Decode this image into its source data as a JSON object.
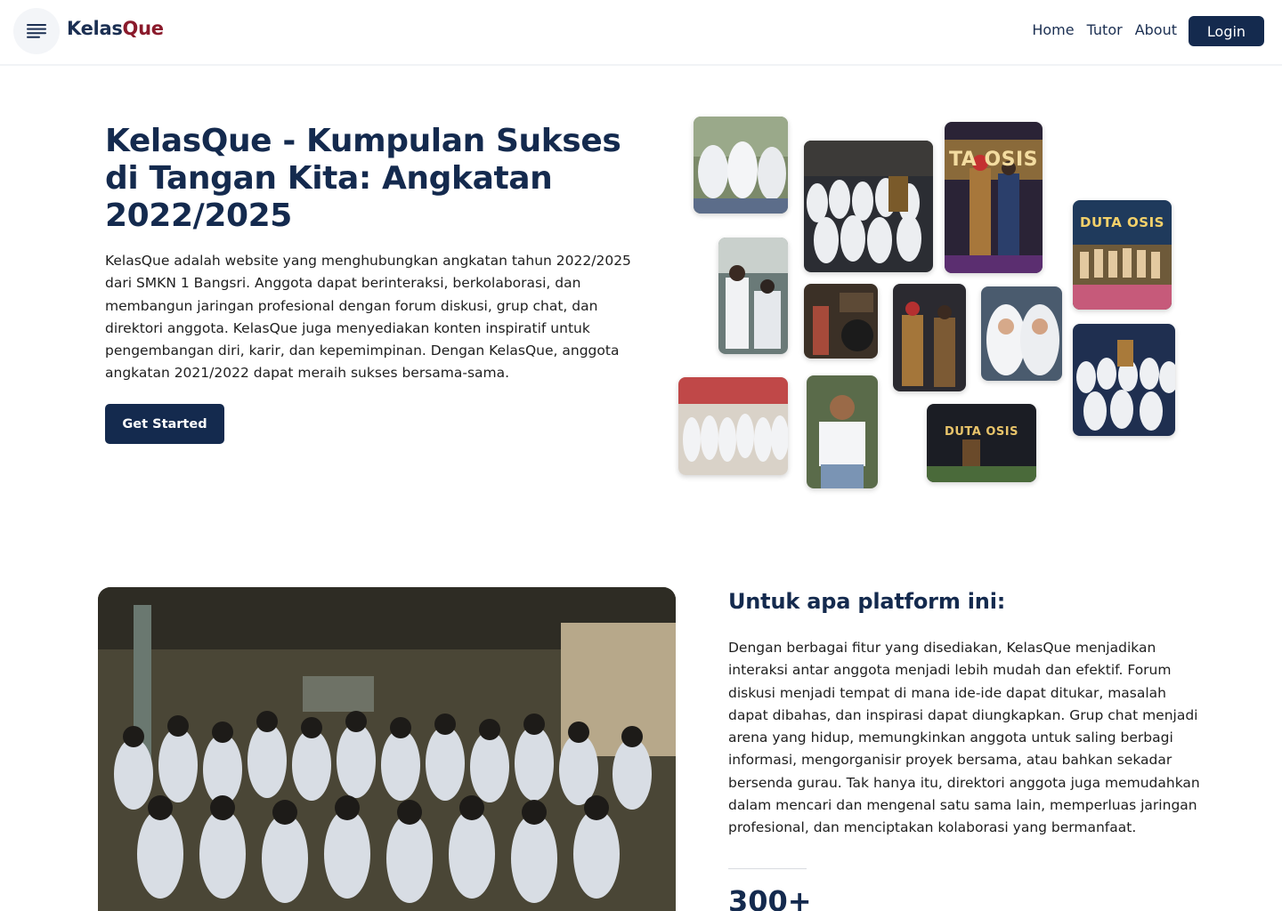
{
  "navbar": {
    "brand_part1": "Kelas",
    "brand_part2": "Que",
    "menu_icon": "hamburger-menu-icon",
    "links": [
      "Home",
      "Tutor",
      "About"
    ],
    "login_label": "Login"
  },
  "hero": {
    "title": "KelasQue - Kumpulan Sukses di Tangan Kita: Angkatan 2022/2025",
    "description": "KelasQue adalah website yang menghubungkan angkatan tahun 2022/2025 dari SMKN 1 Bangsri. Anggota dapat berinteraksi, berkolaborasi, dan membangun jaringan profesional dengan forum diskusi, grup chat, dan direktori anggota. KelasQue juga menyediakan konten inspiratif untuk pengembangan diri, karir, dan kepemimpinan. Dengan KelasQue, anggota angkatan 2021/2022 dapat meraih sukses bersama-sama.",
    "cta_label": "Get Started"
  },
  "collage": {
    "label_tatosis": "TA OSIS",
    "label_duta1": "DUTA OSIS",
    "label_duta2": "DUTA OSIS"
  },
  "section2": {
    "title": "Untuk apa platform ini:",
    "text": "Dengan berbagai fitur yang disediakan, KelasQue menjadikan interaksi antar anggota menjadi lebih mudah dan efektif. Forum diskusi menjadi tempat di mana ide-ide dapat ditukar, masalah dapat dibahas, dan inspirasi dapat diungkapkan. Grup chat menjadi arena yang hidup, memungkinkan anggota untuk saling berbagi informasi, mengorganisir proyek bersama, atau bahkan sekadar bersenda gurau. Tak hanya itu, direktori anggota juga memudahkan dalam mencari dan mengenal satu sama lain, memperluas jaringan profesional, dan menciptakan kolaborasi yang bermanfaat.",
    "stat_value": "300+"
  },
  "colors": {
    "navy": "#142a4e",
    "brand_red": "#8a1a2b"
  }
}
